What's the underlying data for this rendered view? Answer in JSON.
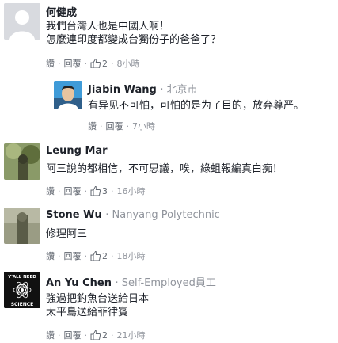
{
  "comments": [
    {
      "name": "何健成",
      "affiliation": "",
      "lines": [
        "我們台灣人也是中國人啊！",
        "怎麼連印度都變成台獨份子的爸爸了？"
      ],
      "actions": {
        "like": "讚",
        "reply": "回覆",
        "count": "2",
        "time": "8小時"
      },
      "avatar_color": "#d8dadf"
    },
    {
      "name": "Jiabin Wang",
      "affiliation": "北京市",
      "lines": [
        "有异见不可怕，可怕的是为了目的，放弃尊严。"
      ],
      "actions": {
        "like": "讚",
        "reply": "回覆",
        "time": "7小時"
      },
      "avatar_color": "#3f9bd8"
    },
    {
      "name": "Leung Mar",
      "affiliation": "",
      "lines": [
        "阿三說的都相信，不可思議，唉，綠蛆報編真白痴！"
      ],
      "actions": {
        "like": "讚",
        "reply": "回覆",
        "count": "3",
        "time": "16小時"
      },
      "avatar_color": "#6b7a48"
    },
    {
      "name": "Stone Wu",
      "affiliation": "Nanyang Polytechnic",
      "lines": [
        "修理阿三"
      ],
      "actions": {
        "like": "讚",
        "reply": "回覆",
        "count": "2",
        "time": "18小時"
      },
      "avatar_color": "#7d7f6a"
    },
    {
      "name": "An Yu Chen",
      "affiliation": "Self-Employed員工",
      "lines": [
        "強過把釣魚台送給日本",
        "太平島送給菲律賓"
      ],
      "actions": {
        "like": "讚",
        "reply": "回覆",
        "count": "2",
        "time": "21小時"
      },
      "avatar_text": [
        "Y'ALL NEED",
        "SCIENCE"
      ],
      "avatar_color": "#111111"
    }
  ]
}
